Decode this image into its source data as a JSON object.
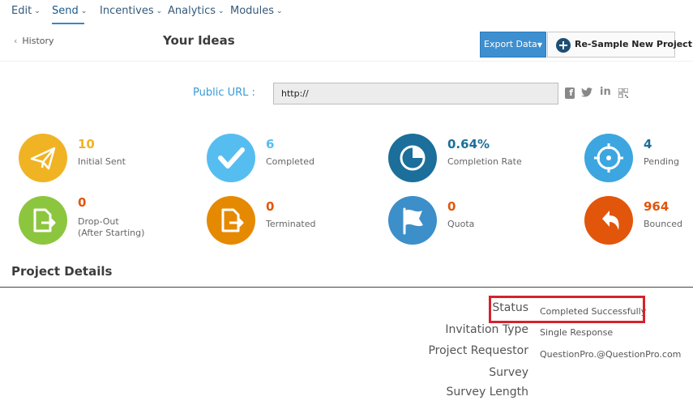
{
  "nav": {
    "items": [
      {
        "label": "Edit"
      },
      {
        "label": "Send"
      },
      {
        "label": "Incentives"
      },
      {
        "label": "Analytics"
      },
      {
        "label": "Modules"
      }
    ],
    "active": "Send"
  },
  "header": {
    "back_label": "History",
    "title": "Your Ideas",
    "export_label": "Export Data",
    "resample_label": "Re-Sample New Project"
  },
  "public_url": {
    "label": "Public URL :",
    "value": "http://"
  },
  "stats": [
    {
      "value": "10",
      "label": "Initial Sent",
      "color": "#f0b323"
    },
    {
      "value": "6",
      "label": "Completed",
      "color": "#56bdf0"
    },
    {
      "value": "0.64%",
      "label": "Completion Rate",
      "color": "#1b6f9a"
    },
    {
      "value": "4",
      "label": "Pending",
      "color": "#2f8ccc"
    },
    {
      "value": "0",
      "label": "Drop-Out",
      "label2": "(After Starting)",
      "color": "#8cc63f"
    },
    {
      "value": "0",
      "label": "Terminated",
      "color": "#e58a00"
    },
    {
      "value": "0",
      "label": "Quota",
      "color": "#3c8fc9"
    },
    {
      "value": "964",
      "label": "Bounced",
      "color": "#e2560b"
    }
  ],
  "project_details": {
    "title": "Project Details",
    "rows": [
      {
        "label": "Status",
        "value": "Completed Successfully"
      },
      {
        "label": "Invitation Type",
        "value": "Single Response"
      },
      {
        "label": "Project Requestor",
        "value": "QuestionPro.@QuestionPro.com"
      },
      {
        "label": "Survey",
        "value": ""
      },
      {
        "label": "Survey Length",
        "value": ""
      }
    ]
  }
}
